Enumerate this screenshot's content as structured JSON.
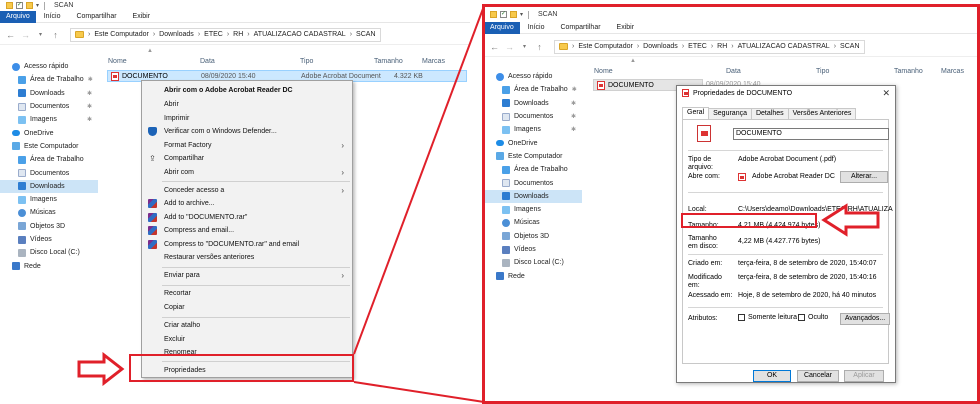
{
  "ribbon": {
    "file": "Arquivo",
    "home": "Início",
    "share": "Compartilhar",
    "view": "Exibir"
  },
  "window_title": "SCAN",
  "breadcrumb": [
    "Este Computador",
    "Downloads",
    "ETEC",
    "RH",
    "ATUALIZACAO CADASTRAL",
    "SCAN"
  ],
  "sidebar": {
    "quick_access": "Acesso rápido",
    "quick_items": [
      "Área de Trabalho",
      "Downloads",
      "Documentos",
      "Imagens"
    ],
    "onedrive": "OneDrive",
    "this_pc": "Este Computador",
    "pc_items": [
      "Área de Trabalho",
      "Documentos",
      "Downloads",
      "Imagens",
      "Músicas",
      "Objetos 3D",
      "Vídeos",
      "Disco Local (C:)"
    ],
    "network": "Rede"
  },
  "columns": {
    "name": "Nome",
    "date": "Data",
    "type": "Tipo",
    "size": "Tamanho",
    "tags": "Marcas"
  },
  "file": {
    "name": "DOCUMENTO",
    "date": "08/09/2020 15:40",
    "type": "Adobe Acrobat Document",
    "size": "4.322 KB"
  },
  "right_file_date_partial": "08/09/2020 15:40",
  "context_menu": {
    "open_with_acrobat": "Abrir com o Adobe Acrobat Reader DC",
    "open": "Abrir",
    "print": "Imprimir",
    "defender": "Verificar com o Windows Defender...",
    "format_factory": "Format Factory",
    "share": "Compartilhar",
    "open_with": "Abrir com",
    "grant_access": "Conceder acesso a",
    "add_archive": "Add to archive...",
    "add_rar": "Add to \"DOCUMENTO.rar\"",
    "compress_email": "Compress and email...",
    "compress_rar_email": "Compress to \"DOCUMENTO.rar\" and email",
    "restore_versions": "Restaurar versões anteriores",
    "send_to": "Enviar para",
    "cut": "Recortar",
    "copy": "Copiar",
    "create_shortcut": "Criar atalho",
    "delete": "Excluir",
    "rename": "Renomear",
    "properties": "Propriedades"
  },
  "properties_dialog": {
    "title": "Propriedades de DOCUMENTO",
    "tabs": [
      "Geral",
      "Segurança",
      "Detalhes",
      "Versões Anteriores"
    ],
    "name_value": "DOCUMENTO",
    "file_type_label": "Tipo de arquivo:",
    "file_type_value": "Adobe Acrobat Document (.pdf)",
    "opens_with_label": "Abre com:",
    "opens_with_value": "Adobe Acrobat Reader DC",
    "change_button": "Alterar...",
    "location_label": "Local:",
    "location_value": "C:\\Users\\deamo\\Downloads\\ETEC\\RH\\ATUALIZA",
    "size_label": "Tamanho:",
    "size_value": "4,21 MB (4.424.974 bytes)",
    "size_on_disk_label": "Tamanho em disco:",
    "size_on_disk_value": "4,22 MB (4.427.776 bytes)",
    "created_label": "Criado em:",
    "created_value": "terça-feira, 8 de setembro de 2020, 15:40:07",
    "modified_label": "Modificado em:",
    "modified_value": "terça-feira, 8 de setembro de 2020, 15:40:16",
    "accessed_label": "Acessado em:",
    "accessed_value": "Hoje, 8 de setembro de 2020, há 40 minutos",
    "attributes_label": "Atributos:",
    "readonly_label": "Somente leitura",
    "hidden_label": "Oculto",
    "advanced_button": "Avançados...",
    "ok_button": "OK",
    "cancel_button": "Cancelar",
    "apply_button": "Aplicar"
  },
  "colors": {
    "annotation_red": "#e0202a",
    "selection_blue": "#cce8ff",
    "file_tab_blue": "#1a5fb4"
  }
}
